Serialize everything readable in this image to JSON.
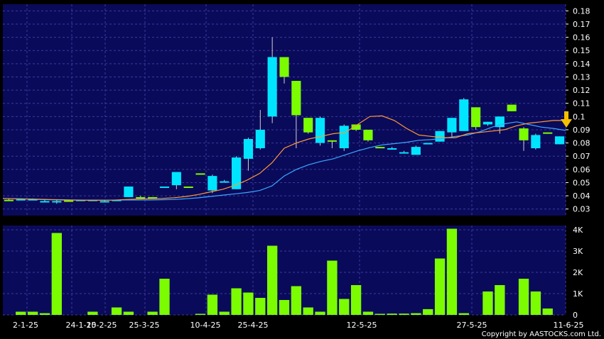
{
  "chart_data": [
    {
      "type": "candlestick",
      "panel": "price",
      "ylim": [
        0.025,
        0.185
      ],
      "yticks": [
        "0.03",
        "0.04",
        "0.05",
        "0.06",
        "0.07",
        "0.08",
        "0.09",
        "0.1",
        "0.11",
        "0.12",
        "0.13",
        "0.14",
        "0.15",
        "0.16",
        "0.17",
        "0.18"
      ],
      "grid": true,
      "colors": {
        "up": "#00e5ff",
        "down": "#7cfc00",
        "ma_short": "#ff9933",
        "ma_long": "#3aa8ff",
        "background": "#0a0a5a",
        "grid": "#3a3aa0"
      },
      "candles": [
        {
          "o": 0.037,
          "h": 0.038,
          "l": 0.036,
          "c": 0.036,
          "dir": "down"
        },
        {
          "o": 0.0375,
          "h": 0.038,
          "l": 0.037,
          "c": 0.0375,
          "dir": "up"
        },
        {
          "o": 0.0375,
          "h": 0.038,
          "l": 0.037,
          "c": 0.0375,
          "dir": "up"
        },
        {
          "o": 0.036,
          "h": 0.037,
          "l": 0.035,
          "c": 0.035,
          "dir": "up"
        },
        {
          "o": 0.036,
          "h": 0.037,
          "l": 0.034,
          "c": 0.035,
          "dir": "up"
        },
        {
          "o": 0.0365,
          "h": 0.037,
          "l": 0.036,
          "c": 0.036,
          "dir": "down"
        },
        {
          "o": 0.037,
          "h": 0.037,
          "l": 0.036,
          "c": 0.036,
          "dir": "up"
        },
        {
          "o": 0.037,
          "h": 0.037,
          "l": 0.037,
          "c": 0.037,
          "dir": "up"
        },
        {
          "o": 0.036,
          "h": 0.037,
          "l": 0.035,
          "c": 0.036,
          "dir": "up"
        },
        {
          "o": 0.037,
          "h": 0.037,
          "l": 0.037,
          "c": 0.037,
          "dir": "up"
        },
        {
          "o": 0.039,
          "h": 0.047,
          "l": 0.039,
          "c": 0.047,
          "dir": "up"
        },
        {
          "o": 0.039,
          "h": 0.04,
          "l": 0.039,
          "c": 0.039,
          "dir": "down"
        },
        {
          "o": 0.039,
          "h": 0.039,
          "l": 0.039,
          "c": 0.039,
          "dir": "down"
        },
        {
          "o": 0.047,
          "h": 0.047,
          "l": 0.047,
          "c": 0.047,
          "dir": "up"
        },
        {
          "o": 0.048,
          "h": 0.058,
          "l": 0.045,
          "c": 0.058,
          "dir": "up"
        },
        {
          "o": 0.047,
          "h": 0.047,
          "l": 0.047,
          "c": 0.047,
          "dir": "down"
        },
        {
          "o": 0.057,
          "h": 0.057,
          "l": 0.057,
          "c": 0.057,
          "dir": "down"
        },
        {
          "o": 0.044,
          "h": 0.056,
          "l": 0.042,
          "c": 0.055,
          "dir": "up"
        },
        {
          "o": 0.051,
          "h": 0.052,
          "l": 0.05,
          "c": 0.051,
          "dir": "up"
        },
        {
          "o": 0.045,
          "h": 0.07,
          "l": 0.045,
          "c": 0.069,
          "dir": "up"
        },
        {
          "o": 0.068,
          "h": 0.084,
          "l": 0.059,
          "c": 0.083,
          "dir": "up"
        },
        {
          "o": 0.076,
          "h": 0.105,
          "l": 0.075,
          "c": 0.09,
          "dir": "up"
        },
        {
          "o": 0.1,
          "h": 0.16,
          "l": 0.095,
          "c": 0.145,
          "dir": "up"
        },
        {
          "o": 0.145,
          "h": 0.145,
          "l": 0.125,
          "c": 0.13,
          "dir": "down"
        },
        {
          "o": 0.127,
          "h": 0.127,
          "l": 0.076,
          "c": 0.101,
          "dir": "down"
        },
        {
          "o": 0.099,
          "h": 0.099,
          "l": 0.087,
          "c": 0.088,
          "dir": "down"
        },
        {
          "o": 0.08,
          "h": 0.1,
          "l": 0.078,
          "c": 0.099,
          "dir": "up"
        },
        {
          "o": 0.082,
          "h": 0.082,
          "l": 0.076,
          "c": 0.082,
          "dir": "down"
        },
        {
          "o": 0.076,
          "h": 0.094,
          "l": 0.074,
          "c": 0.093,
          "dir": "up"
        },
        {
          "o": 0.094,
          "h": 0.094,
          "l": 0.089,
          "c": 0.09,
          "dir": "down"
        },
        {
          "o": 0.09,
          "h": 0.09,
          "l": 0.081,
          "c": 0.082,
          "dir": "down"
        },
        {
          "o": 0.077,
          "h": 0.077,
          "l": 0.076,
          "c": 0.077,
          "dir": "down"
        },
        {
          "o": 0.076,
          "h": 0.077,
          "l": 0.075,
          "c": 0.076,
          "dir": "up"
        },
        {
          "o": 0.073,
          "h": 0.074,
          "l": 0.073,
          "c": 0.073,
          "dir": "up"
        },
        {
          "o": 0.071,
          "h": 0.078,
          "l": 0.071,
          "c": 0.077,
          "dir": "up"
        },
        {
          "o": 0.08,
          "h": 0.08,
          "l": 0.08,
          "c": 0.08,
          "dir": "up"
        },
        {
          "o": 0.081,
          "h": 0.089,
          "l": 0.081,
          "c": 0.089,
          "dir": "up"
        },
        {
          "o": 0.088,
          "h": 0.099,
          "l": 0.084,
          "c": 0.099,
          "dir": "up"
        },
        {
          "o": 0.089,
          "h": 0.114,
          "l": 0.089,
          "c": 0.113,
          "dir": "up"
        },
        {
          "o": 0.107,
          "h": 0.107,
          "l": 0.09,
          "c": 0.092,
          "dir": "down"
        },
        {
          "o": 0.094,
          "h": 0.096,
          "l": 0.093,
          "c": 0.096,
          "dir": "up"
        },
        {
          "o": 0.092,
          "h": 0.1,
          "l": 0.087,
          "c": 0.1,
          "dir": "up"
        },
        {
          "o": 0.109,
          "h": 0.109,
          "l": 0.104,
          "c": 0.104,
          "dir": "down"
        },
        {
          "o": 0.091,
          "h": 0.092,
          "l": 0.074,
          "c": 0.082,
          "dir": "down"
        },
        {
          "o": 0.076,
          "h": 0.087,
          "l": 0.075,
          "c": 0.086,
          "dir": "up"
        },
        {
          "o": 0.087,
          "h": 0.088,
          "l": 0.087,
          "c": 0.088,
          "dir": "down"
        },
        {
          "o": 0.079,
          "h": 0.085,
          "l": 0.079,
          "c": 0.085,
          "dir": "up"
        }
      ],
      "ma_short": [
        0.038,
        0.0378,
        0.0375,
        0.0372,
        0.037,
        0.0368,
        0.0367,
        0.0366,
        0.0366,
        0.0367,
        0.0372,
        0.0375,
        0.0378,
        0.038,
        0.0385,
        0.0395,
        0.041,
        0.043,
        0.045,
        0.048,
        0.052,
        0.057,
        0.065,
        0.076,
        0.08,
        0.083,
        0.085,
        0.087,
        0.088,
        0.094,
        0.1,
        0.1005,
        0.097,
        0.091,
        0.086,
        0.085,
        0.084,
        0.084,
        0.087,
        0.088,
        0.089,
        0.09,
        0.093,
        0.095,
        0.096,
        0.097,
        0.097
      ],
      "ma_long": [
        0.038,
        0.0378,
        0.0376,
        0.0374,
        0.0372,
        0.037,
        0.0368,
        0.0367,
        0.0367,
        0.0367,
        0.0368,
        0.0368,
        0.0368,
        0.037,
        0.0372,
        0.0378,
        0.0385,
        0.0395,
        0.0405,
        0.0415,
        0.0425,
        0.044,
        0.0475,
        0.055,
        0.06,
        0.0635,
        0.066,
        0.068,
        0.071,
        0.074,
        0.0765,
        0.0785,
        0.0795,
        0.0805,
        0.082,
        0.0825,
        0.0835,
        0.085,
        0.086,
        0.0885,
        0.092,
        0.0945,
        0.096,
        0.094,
        0.092,
        0.091,
        0.0895
      ]
    },
    {
      "type": "bar",
      "panel": "volume",
      "ylim": [
        0,
        4200
      ],
      "yticks": [
        "0",
        "1K",
        "2K",
        "3K",
        "4K"
      ],
      "values": [
        0,
        150,
        150,
        80,
        3850,
        0,
        0,
        150,
        0,
        350,
        150,
        0,
        150,
        1700,
        0,
        0,
        50,
        950,
        150,
        1250,
        1050,
        800,
        3250,
        700,
        1350,
        350,
        150,
        2550,
        750,
        1400,
        150,
        50,
        60,
        60,
        80,
        270,
        2650,
        4050,
        80,
        0,
        1100,
        1400,
        0,
        1700,
        1100,
        300,
        0
      ],
      "color": "#7cfc00"
    }
  ],
  "x_labels": [
    "2-1-25",
    "24-1-25",
    "10-2-25",
    "25-3-25",
    "25-3-25",
    "10-4-25",
    "25-4-25",
    "12-5-25",
    "27-5-25",
    "11-6-25"
  ],
  "copyright": "Copyright by AASTOCKS.com Ltd.",
  "arrow_icon": "down-arrow-icon"
}
